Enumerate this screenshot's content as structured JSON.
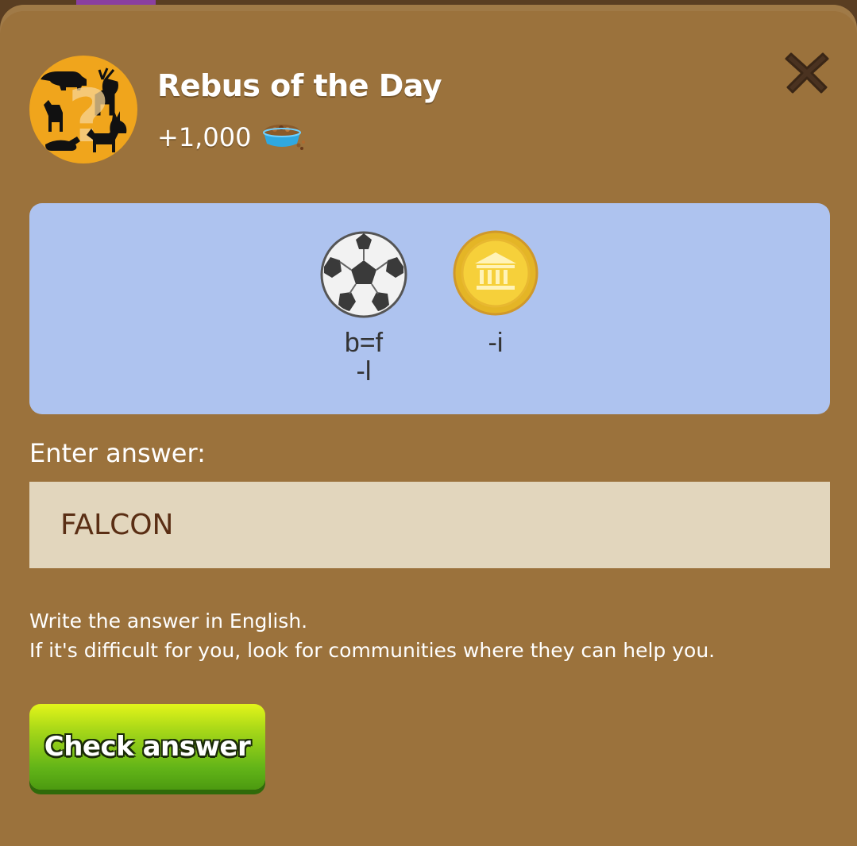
{
  "dialog": {
    "title": "Rebus of the Day",
    "reward": "+1,000",
    "reward_icon": "pet-food-bowl-icon",
    "close_icon": "close-icon"
  },
  "rebus": {
    "items": [
      {
        "icon": "soccer-ball-icon",
        "hint": "b=f\n-l"
      },
      {
        "icon": "gold-coin-icon",
        "hint": "-i"
      }
    ]
  },
  "answer": {
    "label": "Enter answer:",
    "value": "FALCON"
  },
  "instructions": {
    "line1": "Write the answer in English.",
    "line2": "If it's difficult for you, look for communities where they can help you."
  },
  "actions": {
    "check_label": "Check answer"
  },
  "colors": {
    "dialog_bg": "#9b723c",
    "panel_bg": "#aec3ef",
    "input_bg": "#e2d6bd",
    "button_green": "#62b418"
  }
}
